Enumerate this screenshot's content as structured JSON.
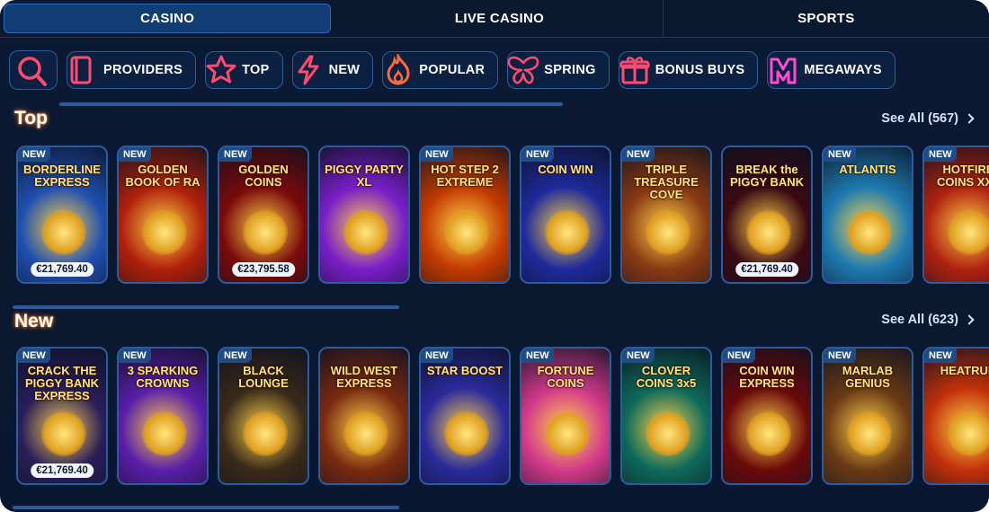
{
  "tabs": [
    {
      "label": "CASINO",
      "active": true
    },
    {
      "label": "LIVE CASINO",
      "active": false
    },
    {
      "label": "SPORTS",
      "active": false
    }
  ],
  "categories": [
    {
      "label": "PROVIDERS",
      "icon": "book-icon",
      "color": "#ff4b6e"
    },
    {
      "label": "TOP",
      "icon": "star-icon",
      "color": "#ff4b6e"
    },
    {
      "label": "NEW",
      "icon": "lightning-icon",
      "color": "#ff4b6e"
    },
    {
      "label": "POPULAR",
      "icon": "flame-icon",
      "color": "#ff6a3a"
    },
    {
      "label": "SPRING",
      "icon": "butterfly-icon",
      "color": "#ff4b6e"
    },
    {
      "label": "BONUS BUYS",
      "icon": "gift-icon",
      "color": "#ff4b6e"
    },
    {
      "label": "MEGAWAYS",
      "icon": "m-logo-icon",
      "color": "#ff4bd0"
    }
  ],
  "sections": [
    {
      "title": "Top",
      "see_all": "See All (567)",
      "games": [
        {
          "title": "BORDERLINE EXPRESS",
          "badge": "NEW",
          "jackpot": "€21,769.40",
          "bg": "#1f4fb0"
        },
        {
          "title": "GOLDEN BOOK OF RA",
          "badge": "NEW",
          "jackpot": "",
          "bg": "#b0200a"
        },
        {
          "title": "GOLDEN COINS",
          "badge": "NEW",
          "jackpot": "€23,795.58",
          "bg": "#7a0a0a"
        },
        {
          "title": "PIGGY PARTY XL",
          "badge": "",
          "jackpot": "",
          "bg": "#7a1ec8"
        },
        {
          "title": "HOT STEP 2 EXTREME",
          "badge": "NEW",
          "jackpot": "",
          "bg": "#c23a00"
        },
        {
          "title": "COIN WIN",
          "badge": "NEW",
          "jackpot": "",
          "bg": "#1e2a9a"
        },
        {
          "title": "TRIPLE TREASURE COVE",
          "badge": "NEW",
          "jackpot": "",
          "bg": "#8a3a12"
        },
        {
          "title": "BREAK the PIGGY BANK",
          "badge": "",
          "jackpot": "€21,769.40",
          "bg": "#3a0a14"
        },
        {
          "title": "ATLANTIS",
          "badge": "NEW",
          "jackpot": "",
          "bg": "#1d7ab0"
        },
        {
          "title": "HOTFIRE COINS XXL",
          "badge": "NEW",
          "jackpot": "",
          "bg": "#b02210"
        }
      ]
    },
    {
      "title": "New",
      "see_all": "See All (623)",
      "games": [
        {
          "title": "CRACK THE PIGGY BANK EXPRESS",
          "badge": "NEW",
          "jackpot": "€21,769.40",
          "bg": "#2a1e5a"
        },
        {
          "title": "3 SPARKING CROWNS",
          "badge": "NEW",
          "jackpot": "",
          "bg": "#5a1ea8"
        },
        {
          "title": "BLACK LOUNGE",
          "badge": "NEW",
          "jackpot": "",
          "bg": "#3a2a1a"
        },
        {
          "title": "WILD WEST EXPRESS",
          "badge": "",
          "jackpot": "",
          "bg": "#7a2a10"
        },
        {
          "title": "STAR BOOST",
          "badge": "NEW",
          "jackpot": "",
          "bg": "#2a2a9a"
        },
        {
          "title": "FORTUNE COINS",
          "badge": "NEW",
          "jackpot": "",
          "bg": "#d23a8a"
        },
        {
          "title": "CLOVER COINS 3x5",
          "badge": "NEW",
          "jackpot": "",
          "bg": "#0e6a5a"
        },
        {
          "title": "COIN WIN EXPRESS",
          "badge": "NEW",
          "jackpot": "",
          "bg": "#6a0a0a"
        },
        {
          "title": "MARLAB GENIUS",
          "badge": "NEW",
          "jackpot": "",
          "bg": "#6a3a14"
        },
        {
          "title": "HEATRUN",
          "badge": "NEW",
          "jackpot": "",
          "bg": "#c2300a"
        }
      ]
    }
  ]
}
